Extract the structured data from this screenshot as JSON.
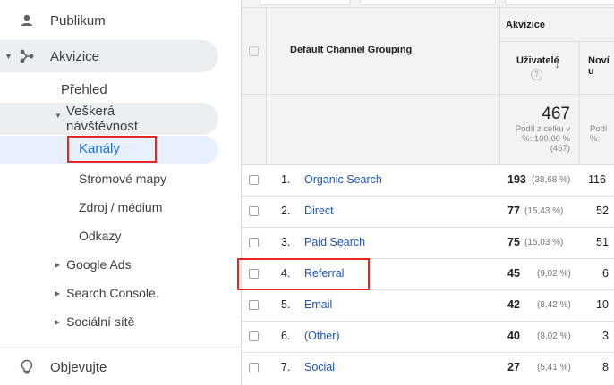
{
  "sidebar": {
    "publikum": "Publikum",
    "akvizice": "Akvizice",
    "prehled": "Přehled",
    "veskera_line1": "Veškerá",
    "veskera_line2": "návštěvnost",
    "kanaly": "Kanály",
    "stromove_mapy": "Stromové mapy",
    "zdroj_medium": "Zdroj / médium",
    "odkazy": "Odkazy",
    "google_ads": "Google Ads",
    "search_console": "Search Console.",
    "socialni_site": "Sociální sítě",
    "objevujte": "Objevujte",
    "icons": {
      "publikum": "person-icon",
      "akvizice": "acquisition-icon",
      "objevujte": "lightbulb-icon"
    }
  },
  "table": {
    "group_header": "Default Channel Grouping",
    "akvizice_header": "Akvizice",
    "col_users": "Uživatelé",
    "col_new_users": "Noví u",
    "total_value": "467",
    "total_note_1": "Podíl z celku v",
    "total_note_2": "%: 100,00 %",
    "total_note_3": "(467)",
    "total_note2_1": "Podí",
    "total_note2_2": "%:",
    "rows": [
      {
        "num": "1.",
        "name": "Organic Search",
        "users": "193",
        "pct": "(38,68 %)",
        "new": "116"
      },
      {
        "num": "2.",
        "name": "Direct",
        "users": "77",
        "pct": "(15,43 %)",
        "new": "52"
      },
      {
        "num": "3.",
        "name": "Paid Search",
        "users": "75",
        "pct": "(15,03 %)",
        "new": "51"
      },
      {
        "num": "4.",
        "name": "Referral",
        "users": "45",
        "pct": "(9,02 %)",
        "new": "6"
      },
      {
        "num": "5.",
        "name": "Email",
        "users": "42",
        "pct": "(8,42 %)",
        "new": "10"
      },
      {
        "num": "6.",
        "name": "(Other)",
        "users": "40",
        "pct": "(8,02 %)",
        "new": "3"
      },
      {
        "num": "7.",
        "name": "Social",
        "users": "27",
        "pct": "(5,41 %)",
        "new": "8"
      }
    ]
  },
  "colors": {
    "highlight_red": "#e8251f",
    "link_blue": "#1a55b8",
    "active_blue": "#1a73e8"
  }
}
